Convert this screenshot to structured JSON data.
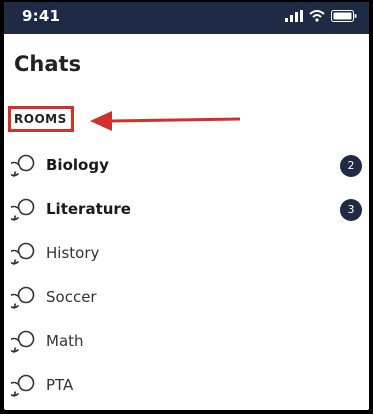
{
  "status_bar": {
    "time": "9:41"
  },
  "header": {
    "title": "Chats"
  },
  "section": {
    "label": "ROOMS"
  },
  "rooms": [
    {
      "name": "Biology",
      "badge": "2"
    },
    {
      "name": "Literature",
      "badge": "3"
    },
    {
      "name": "History"
    },
    {
      "name": "Soccer"
    },
    {
      "name": "Math"
    },
    {
      "name": "PTA"
    }
  ],
  "colors": {
    "status_bar": "#1f2a44",
    "badge": "#1f2a44",
    "highlight": "#d0312d"
  },
  "icons": {
    "room": "chat-bubbles-icon",
    "annotation": "arrow-left-icon"
  }
}
